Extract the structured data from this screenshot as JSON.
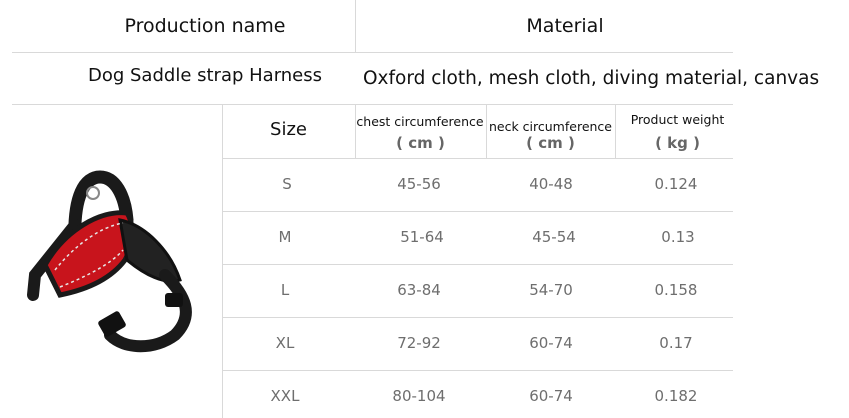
{
  "top_table": {
    "production_name_label": "Production name",
    "material_label": "Material",
    "product_name": "Dog Saddle strap Harness",
    "material_value": "Oxford cloth, mesh cloth, diving material, canvas"
  },
  "size_table": {
    "size_label": "Size",
    "col_chest": "chest circumference",
    "col_chest_unit": "( cm )",
    "col_neck": "neck circumference",
    "col_neck_unit": "( cm )",
    "col_weight": "Product weight",
    "col_weight_unit": "( kg )",
    "rows": [
      {
        "size": "S",
        "chest": "45-56",
        "neck": "40-48",
        "weight": "0.124"
      },
      {
        "size": "M",
        "chest": "51-64",
        "neck": "45-54",
        "weight": "0.13"
      },
      {
        "size": "L",
        "chest": "63-84",
        "neck": "54-70",
        "weight": "0.158"
      },
      {
        "size": "XL",
        "chest": "72-92",
        "neck": "60-74",
        "weight": "0.17"
      },
      {
        "size": "XXL",
        "chest": "80-104",
        "neck": "60-74",
        "weight": "0.182"
      }
    ]
  },
  "colors": {
    "harness_body": "#c8141c",
    "harness_strap": "#1a1a1a",
    "grid_line": "#d9d9d9",
    "value_text": "#6e6e6e"
  }
}
